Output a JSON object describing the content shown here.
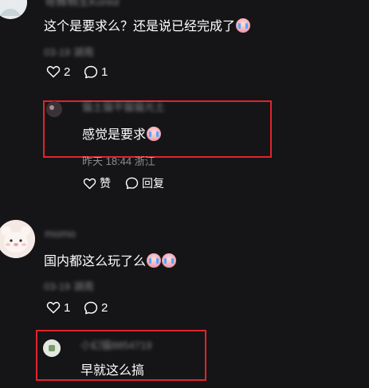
{
  "comments": [
    {
      "username": "哥舞梢生Kored",
      "text": "这个是要求么？还是说已经完成了",
      "date": "03-19 湖南",
      "likes": "2",
      "replies": "1",
      "reply": {
        "username": "猫土猫平猫猫光土",
        "text": "感觉是要求",
        "meta": "昨天 18:44 浙江",
        "like_label": "赞",
        "reply_label": "回复"
      }
    },
    {
      "username": "momo",
      "text": "国内都这么玩了么",
      "date": "03-19 湖南",
      "likes": "1",
      "replies": "2",
      "reply": {
        "username": "小幻猫8854719",
        "text": "早就这么搞"
      }
    }
  ],
  "colors": {
    "background": "#151518",
    "highlight_box": "#e0242b",
    "text": "#ffffff",
    "muted": "#808085"
  },
  "icons": {
    "like": "heart-outline-icon",
    "comment": "speech-bubble-icon",
    "emoji": "crying-face-emoji"
  }
}
